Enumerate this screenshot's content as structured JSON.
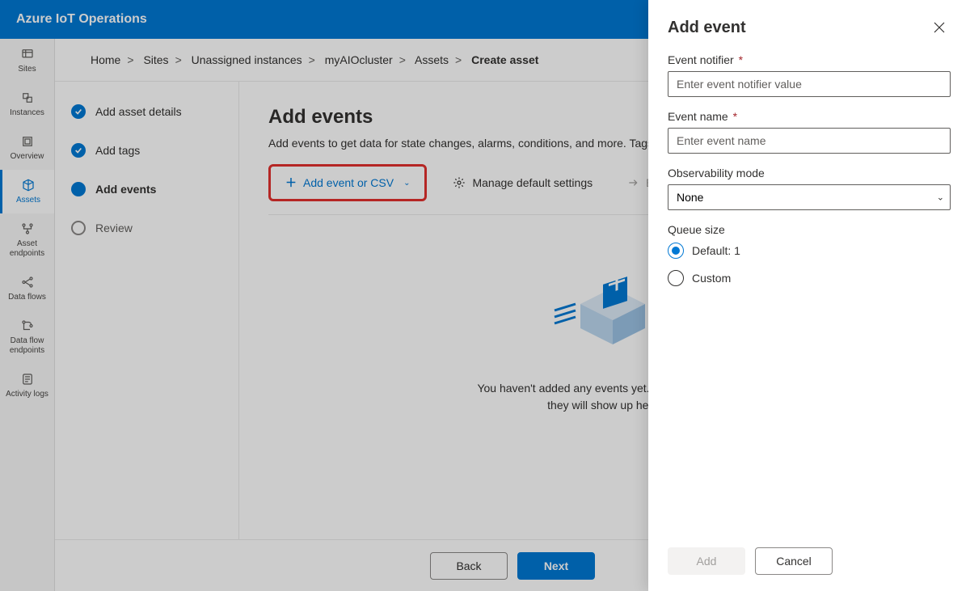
{
  "app_title": "Azure IoT Operations",
  "rail": [
    {
      "label": "Sites"
    },
    {
      "label": "Instances"
    },
    {
      "label": "Overview"
    },
    {
      "label": "Assets"
    },
    {
      "label": "Asset endpoints"
    },
    {
      "label": "Data flows"
    },
    {
      "label": "Data flow endpoints"
    },
    {
      "label": "Activity logs"
    }
  ],
  "breadcrumb": {
    "items": [
      "Home",
      "Sites",
      "Unassigned instances",
      "myAIOcluster",
      "Assets"
    ],
    "current": "Create asset"
  },
  "wizard": {
    "steps": [
      {
        "label": "Add asset details",
        "state": "done"
      },
      {
        "label": "Add tags",
        "state": "done"
      },
      {
        "label": "Add events",
        "state": "active"
      },
      {
        "label": "Review",
        "state": "pending"
      }
    ]
  },
  "page": {
    "title": "Add events",
    "subtitle_full": "Add events to get data for state changes, alarms, conditions, and more. Tags can be edited once the asset is created.",
    "toolbar": {
      "add_label": "Add event or CSV",
      "manage_label": "Manage default settings",
      "export_label": "Ex"
    },
    "empty": {
      "line1": "You haven't added any events yet. Once you have,",
      "line2": "they will show up here."
    }
  },
  "footer": {
    "back": "Back",
    "next": "Next"
  },
  "flyout": {
    "title": "Add event",
    "fields": {
      "notifier_label": "Event notifier",
      "notifier_placeholder": "Enter event notifier value",
      "name_label": "Event name",
      "name_placeholder": "Enter event name",
      "obs_label": "Observability mode",
      "obs_value": "None",
      "queue_label": "Queue size",
      "queue_opt_default": "Default: 1",
      "queue_opt_custom": "Custom"
    },
    "buttons": {
      "add": "Add",
      "cancel": "Cancel"
    }
  }
}
